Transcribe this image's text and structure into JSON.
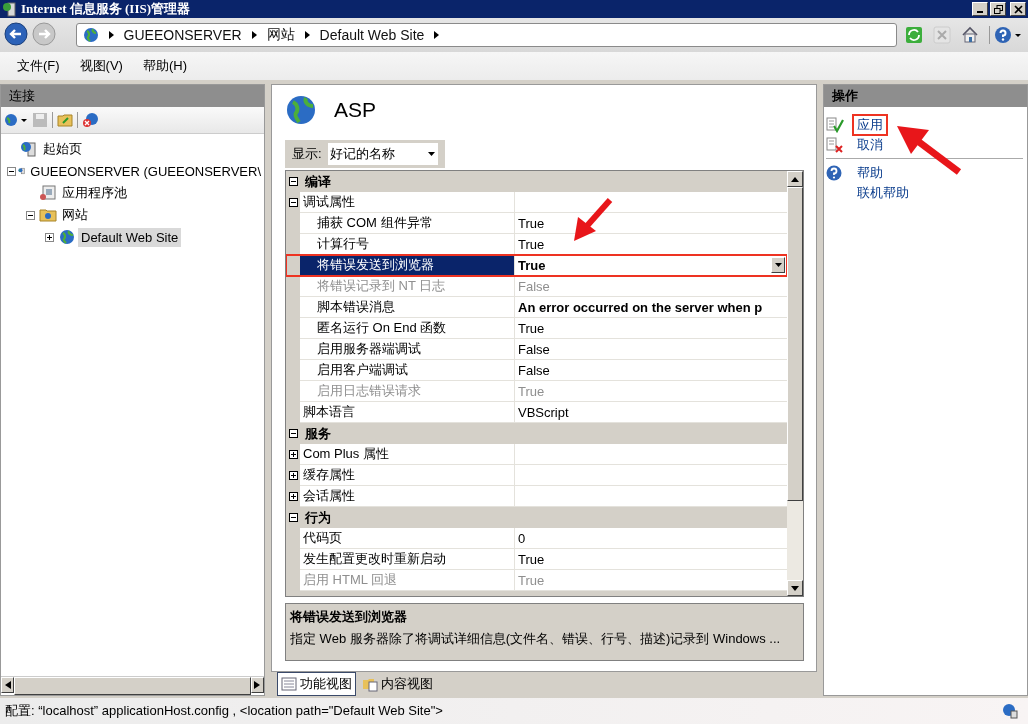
{
  "window": {
    "title": "Internet 信息服务 (IIS)管理器"
  },
  "breadcrumb": [
    "GUEEONSERVER",
    "网站",
    "Default Web Site"
  ],
  "menu": [
    "文件(F)",
    "视图(V)",
    "帮助(H)"
  ],
  "connections": {
    "title": "连接",
    "tree": [
      {
        "label": "起始页",
        "kind": "start",
        "selected": false
      },
      {
        "label": "GUEEONSERVER (GUEEONSERVER\\",
        "kind": "server",
        "expanded": true,
        "selected": false,
        "children": [
          {
            "label": "应用程序池",
            "kind": "pool",
            "selected": false
          },
          {
            "label": "网站",
            "kind": "folder",
            "expanded": true,
            "selected": false,
            "children": [
              {
                "label": "Default Web Site",
                "kind": "site",
                "expanded": false,
                "selected": true
              }
            ]
          }
        ]
      }
    ]
  },
  "feature": {
    "title": "ASP",
    "display_label": "显示:",
    "display_value": "好记的名称",
    "sections": [
      {
        "label": "编译",
        "expanded": true,
        "rows": [
          {
            "label": "调试属性",
            "expanded": true,
            "children": [
              {
                "label": "捕获 COM 组件异常",
                "value": "True",
                "disabled": false,
                "selected": false,
                "modified": false
              },
              {
                "label": "计算行号",
                "value": "True",
                "disabled": false,
                "selected": false,
                "modified": false
              },
              {
                "label": "将错误发送到浏览器",
                "value": "True",
                "disabled": false,
                "selected": true,
                "modified": true,
                "highlighted": true
              },
              {
                "label": "将错误记录到 NT 日志",
                "value": "False",
                "disabled": true,
                "selected": false,
                "modified": false
              },
              {
                "label": "脚本错误消息",
                "value": "An error occurred on the server when p",
                "disabled": false,
                "selected": false,
                "modified": true
              },
              {
                "label": "匿名运行 On End 函数",
                "value": "True",
                "disabled": false,
                "selected": false,
                "modified": false
              },
              {
                "label": "启用服务器端调试",
                "value": "False",
                "disabled": false,
                "selected": false,
                "modified": false
              },
              {
                "label": "启用客户端调试",
                "value": "False",
                "disabled": false,
                "selected": false,
                "modified": false
              },
              {
                "label": "启用日志错误请求",
                "value": "True",
                "disabled": true,
                "selected": false,
                "modified": false
              }
            ]
          },
          {
            "label": "脚本语言",
            "value": "VBScript",
            "disabled": false,
            "selected": false,
            "modified": false
          }
        ]
      },
      {
        "label": "服务",
        "expanded": true,
        "rows": [
          {
            "label": "Com Plus 属性",
            "expanded": false
          },
          {
            "label": "缓存属性",
            "expanded": false
          },
          {
            "label": "会话属性",
            "expanded": false
          }
        ]
      },
      {
        "label": "行为",
        "expanded": true,
        "rows": [
          {
            "label": "代码页",
            "value": "0",
            "disabled": false,
            "selected": false,
            "modified": false
          },
          {
            "label": "发生配置更改时重新启动",
            "value": "True",
            "disabled": false,
            "selected": false,
            "modified": false
          },
          {
            "label": "启用 HTML 回退",
            "value": "True",
            "disabled": true,
            "selected": false,
            "modified": false
          }
        ]
      }
    ],
    "description": {
      "title": "将错误发送到浏览器",
      "text": "指定 Web 服务器除了将调试详细信息(文件名、错误、行号、描述)记录到 Windows ..."
    }
  },
  "view_tabs": [
    {
      "label": "功能视图",
      "kind": "feature",
      "selected": true
    },
    {
      "label": "内容视图",
      "kind": "content",
      "selected": false
    }
  ],
  "actions": {
    "title": "操作",
    "groups": [
      [
        {
          "label": "应用",
          "kind": "apply",
          "highlighted": true
        },
        {
          "label": "取消",
          "kind": "cancel",
          "highlighted": false
        }
      ],
      [
        {
          "label": "帮助",
          "kind": "help",
          "highlighted": false
        },
        {
          "label": "联机帮助",
          "highlighted": false
        }
      ]
    ]
  },
  "status_bar": {
    "text": "配置: “localhost”  applicationHost.config , <location path=\"Default Web Site\">"
  }
}
